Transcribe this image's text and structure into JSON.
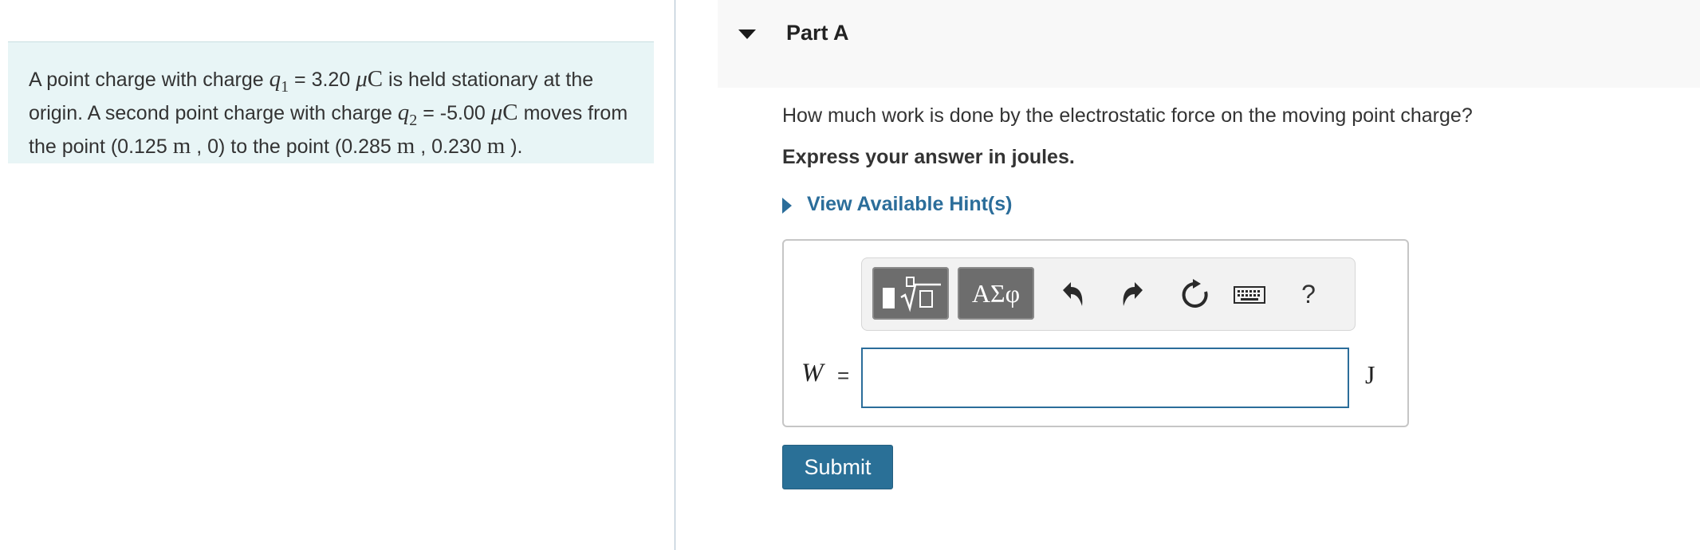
{
  "problem": {
    "intro": "A point charge with charge ",
    "q1_symbol": "q",
    "q1_sub": "1",
    "q1_value": " = 3.20 ",
    "unit_mu": "μ",
    "unit_C": "C",
    "after_q1": " is held stationary at the origin. A second point charge with charge ",
    "q2_symbol": "q",
    "q2_sub": "2",
    "q2_value": " = -5.00 ",
    "after_q2": " moves from the point (0.125 ",
    "unit_m": "m",
    "mid1": " , 0) to the point (0.285 ",
    "mid2": " , 0.230 ",
    "end": " )."
  },
  "part": {
    "title": "Part A",
    "question": "How much work is done by the electrostatic force on the moving point charge?",
    "instruction": "Express your answer in joules.",
    "hint_label": "View Available Hint(s)"
  },
  "toolbar": {
    "symbols_label": "ΑΣφ",
    "help_label": "?",
    "icons": [
      "templates-icon",
      "undo-icon",
      "redo-icon",
      "reset-icon",
      "keyboard-icon",
      "help-icon"
    ]
  },
  "answer": {
    "variable": "W",
    "equals": "=",
    "value": "",
    "unit": "J"
  },
  "submit_label": "Submit",
  "colors": {
    "problem_bg": "#e8f5f6",
    "header_bg": "#f8f8f8",
    "accent": "#2b6d9a",
    "submit_bg": "#2a7097"
  }
}
